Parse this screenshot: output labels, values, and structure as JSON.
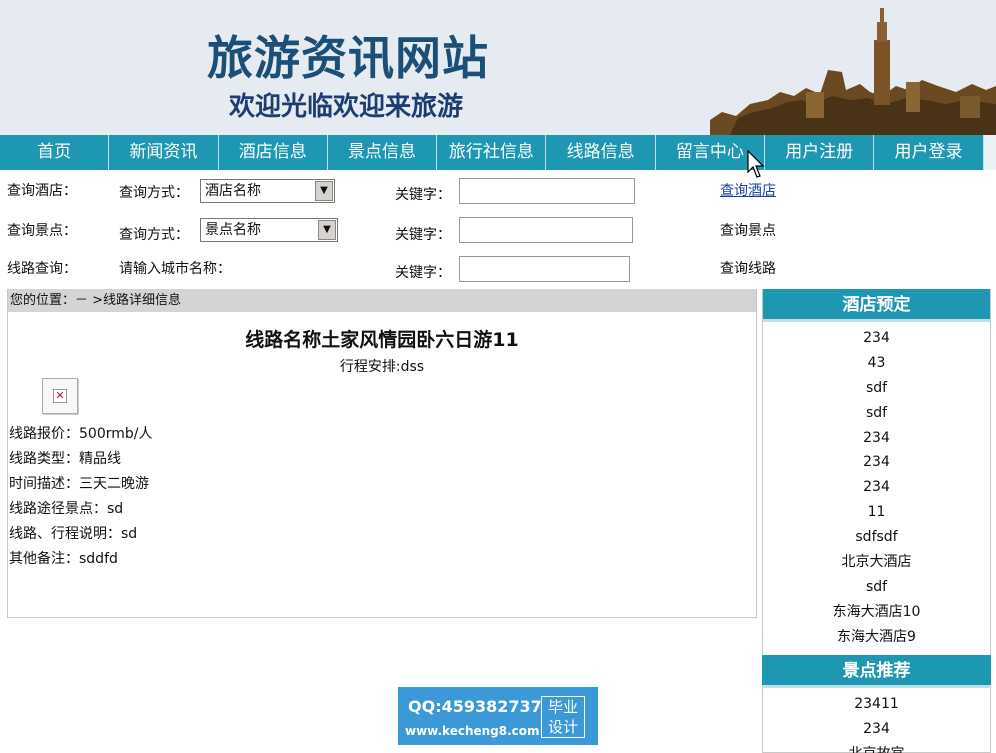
{
  "header": {
    "title": "旅游资讯网站",
    "subtitle": "欢迎光临欢迎来旅游"
  },
  "nav": {
    "items": [
      "首页",
      "新闻资讯",
      "酒店信息",
      "景点信息",
      "旅行社信息",
      "线路信息",
      "留言中心",
      "用户注册",
      "用户登录"
    ]
  },
  "search": {
    "hotel": {
      "label": "查询酒店：",
      "method_label": "查询方式：",
      "select_value": "酒店名称",
      "keyword_label": "关键字：",
      "keyword_value": "",
      "action": "查询酒店"
    },
    "spot": {
      "label": "查询景点：",
      "method_label": "查询方式：",
      "select_value": "景点名称",
      "keyword_label": "关键字：",
      "keyword_value": "",
      "action": "查询景点"
    },
    "route": {
      "label": "线路查询：",
      "prompt": "请输入城市名称：",
      "keyword_label": "关键字：",
      "keyword_value": "",
      "action": "查询线路"
    }
  },
  "main": {
    "breadcrumb": "您的位置：－ >线路详细信息",
    "route_title": "线路名称土家风情园卧六日游11",
    "schedule": "行程安排:dss",
    "details": [
      "线路报价：500rmb/人",
      "线路类型：精品线",
      "时间描述：三天二晚游",
      "线路途径景点：sd",
      "线路、行程说明：sd",
      "其他备注：sddfd"
    ]
  },
  "sidebar": {
    "hotel_header": "酒店预定",
    "hotels": [
      "234",
      "43",
      "sdf",
      "sdf",
      "234",
      "234",
      "234",
      "11",
      "sdfsdf",
      "北京大酒店",
      "sdf",
      "东海大酒店10",
      "东海大酒店9"
    ],
    "spot_header": "景点推荐",
    "spots": [
      "23411",
      "234",
      "北京故宫"
    ]
  },
  "watermark": {
    "qq": "QQ:459382737",
    "url": "www.kecheng8.com",
    "logo_line1": "毕业",
    "logo_line2": "设计"
  },
  "colors": {
    "nav_bg": "#1e97b2",
    "header_bg": "#e5ebf1",
    "title": "#1c4f78",
    "link": "#1a3fa6"
  }
}
